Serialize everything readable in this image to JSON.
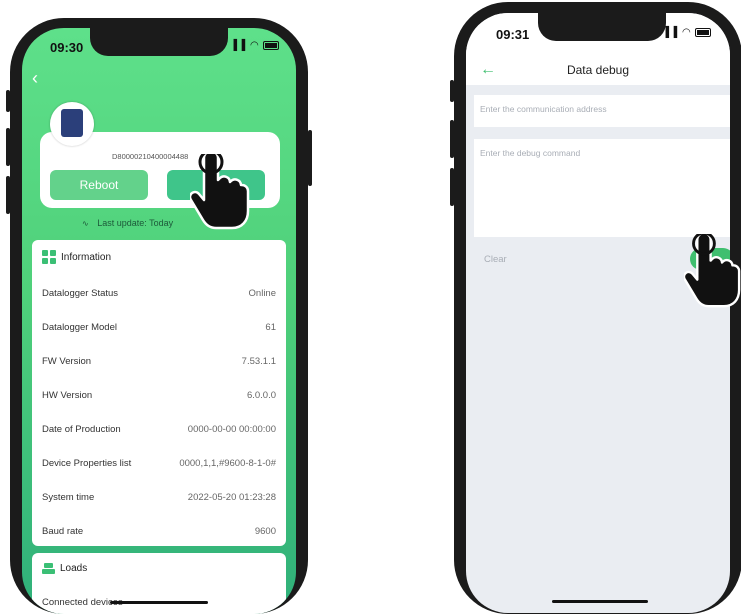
{
  "phone1": {
    "status_time": "09:30",
    "device": {
      "serial": "D80000210400004488",
      "reboot_label": "Reboot",
      "last_update": "Last update: Today"
    },
    "information": {
      "title": "Information",
      "rows": [
        {
          "label": "Datalogger Status",
          "value": "Online"
        },
        {
          "label": "Datalogger Model",
          "value": "61"
        },
        {
          "label": "FW Version",
          "value": "7.53.1.1"
        },
        {
          "label": "HW Version",
          "value": "6.0.0.0"
        },
        {
          "label": "Date of Production",
          "value": "0000-00-00 00:00:00"
        },
        {
          "label": "Device Properties list",
          "value": "0000,1,1,#9600-8-1-0#"
        },
        {
          "label": "System time",
          "value": "2022-05-20 01:23:28"
        },
        {
          "label": "Baud rate",
          "value": "9600"
        }
      ]
    },
    "loads": {
      "title": "Loads",
      "row_label": "Connected devices"
    }
  },
  "phone2": {
    "status_time": "09:31",
    "title": "Data debug",
    "address_placeholder": "Enter the communication address",
    "command_placeholder": "Enter the debug command",
    "clear_label": "Clear"
  },
  "icons": {
    "back": "chevron-left-icon",
    "back_arrow": "arrow-left-icon",
    "information": "grid-icon",
    "loads": "loads-icon",
    "pointer": "hand-pointer-icon"
  },
  "colors": {
    "accent_green": "#3fbf6f",
    "screen_gradient_top": "#5ee08a",
    "screen_gradient_bottom": "#2fb07a",
    "debug_background": "#eaedf2"
  }
}
